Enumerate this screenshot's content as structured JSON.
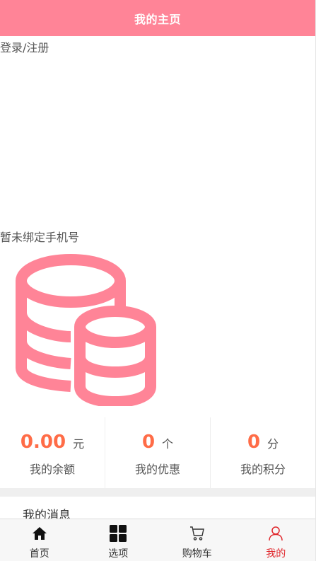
{
  "header": {
    "title": "我的主页"
  },
  "login": {
    "label": "登录/注册"
  },
  "phone": {
    "status": "暂未绑定手机号"
  },
  "colors": {
    "brand": "#ff8497",
    "accent_value": "#ff6c47",
    "active_nav": "#e0252a"
  },
  "stats": [
    {
      "value": "0.00",
      "unit": "元",
      "label": "我的余额"
    },
    {
      "value": "0",
      "unit": "个",
      "label": "我的优惠"
    },
    {
      "value": "0",
      "unit": "分",
      "label": "我的积分"
    }
  ],
  "messages": {
    "label": "我的消息"
  },
  "nav": [
    {
      "label": "首页",
      "icon": "home-icon"
    },
    {
      "label": "选项",
      "icon": "grid-icon"
    },
    {
      "label": "购物车",
      "icon": "cart-icon"
    },
    {
      "label": "我的",
      "icon": "user-icon",
      "active": true
    }
  ]
}
